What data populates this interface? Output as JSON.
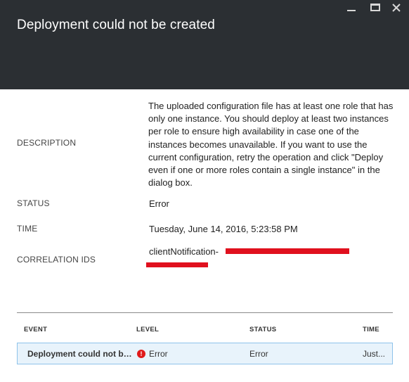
{
  "window": {
    "title": "Deployment could not be created",
    "controls": [
      "minimize-icon",
      "maximize-icon",
      "close-icon"
    ]
  },
  "details": {
    "description_label": "DESCRIPTION",
    "description": "The uploaded configuration file has at least one role that has only one instance. You should deploy at least two instances per role to ensure high availability in case one of the instances becomes unavailable. If you want to use the current configuration, retry the operation and click \"Deploy even if one or more roles contain a single instance\" in the dialog box.",
    "status_label": "STATUS",
    "status": "Error",
    "time_label": "TIME",
    "time": "Tuesday, June 14, 2016, 5:23:58 PM",
    "correlation_label": "CORRELATION IDS",
    "correlation_prefix": "clientNotification-"
  },
  "events": {
    "columns": [
      "EVENT",
      "LEVEL",
      "STATUS",
      "TIME"
    ],
    "rows": [
      {
        "event": "Deployment could not be created",
        "level": "Error",
        "status": "Error",
        "time": "Just..."
      }
    ]
  },
  "colors": {
    "header_bg": "#2b2f33",
    "redaction": "#e0101e",
    "row_highlight": "#e8f3fb",
    "error": "#e01a1a"
  }
}
